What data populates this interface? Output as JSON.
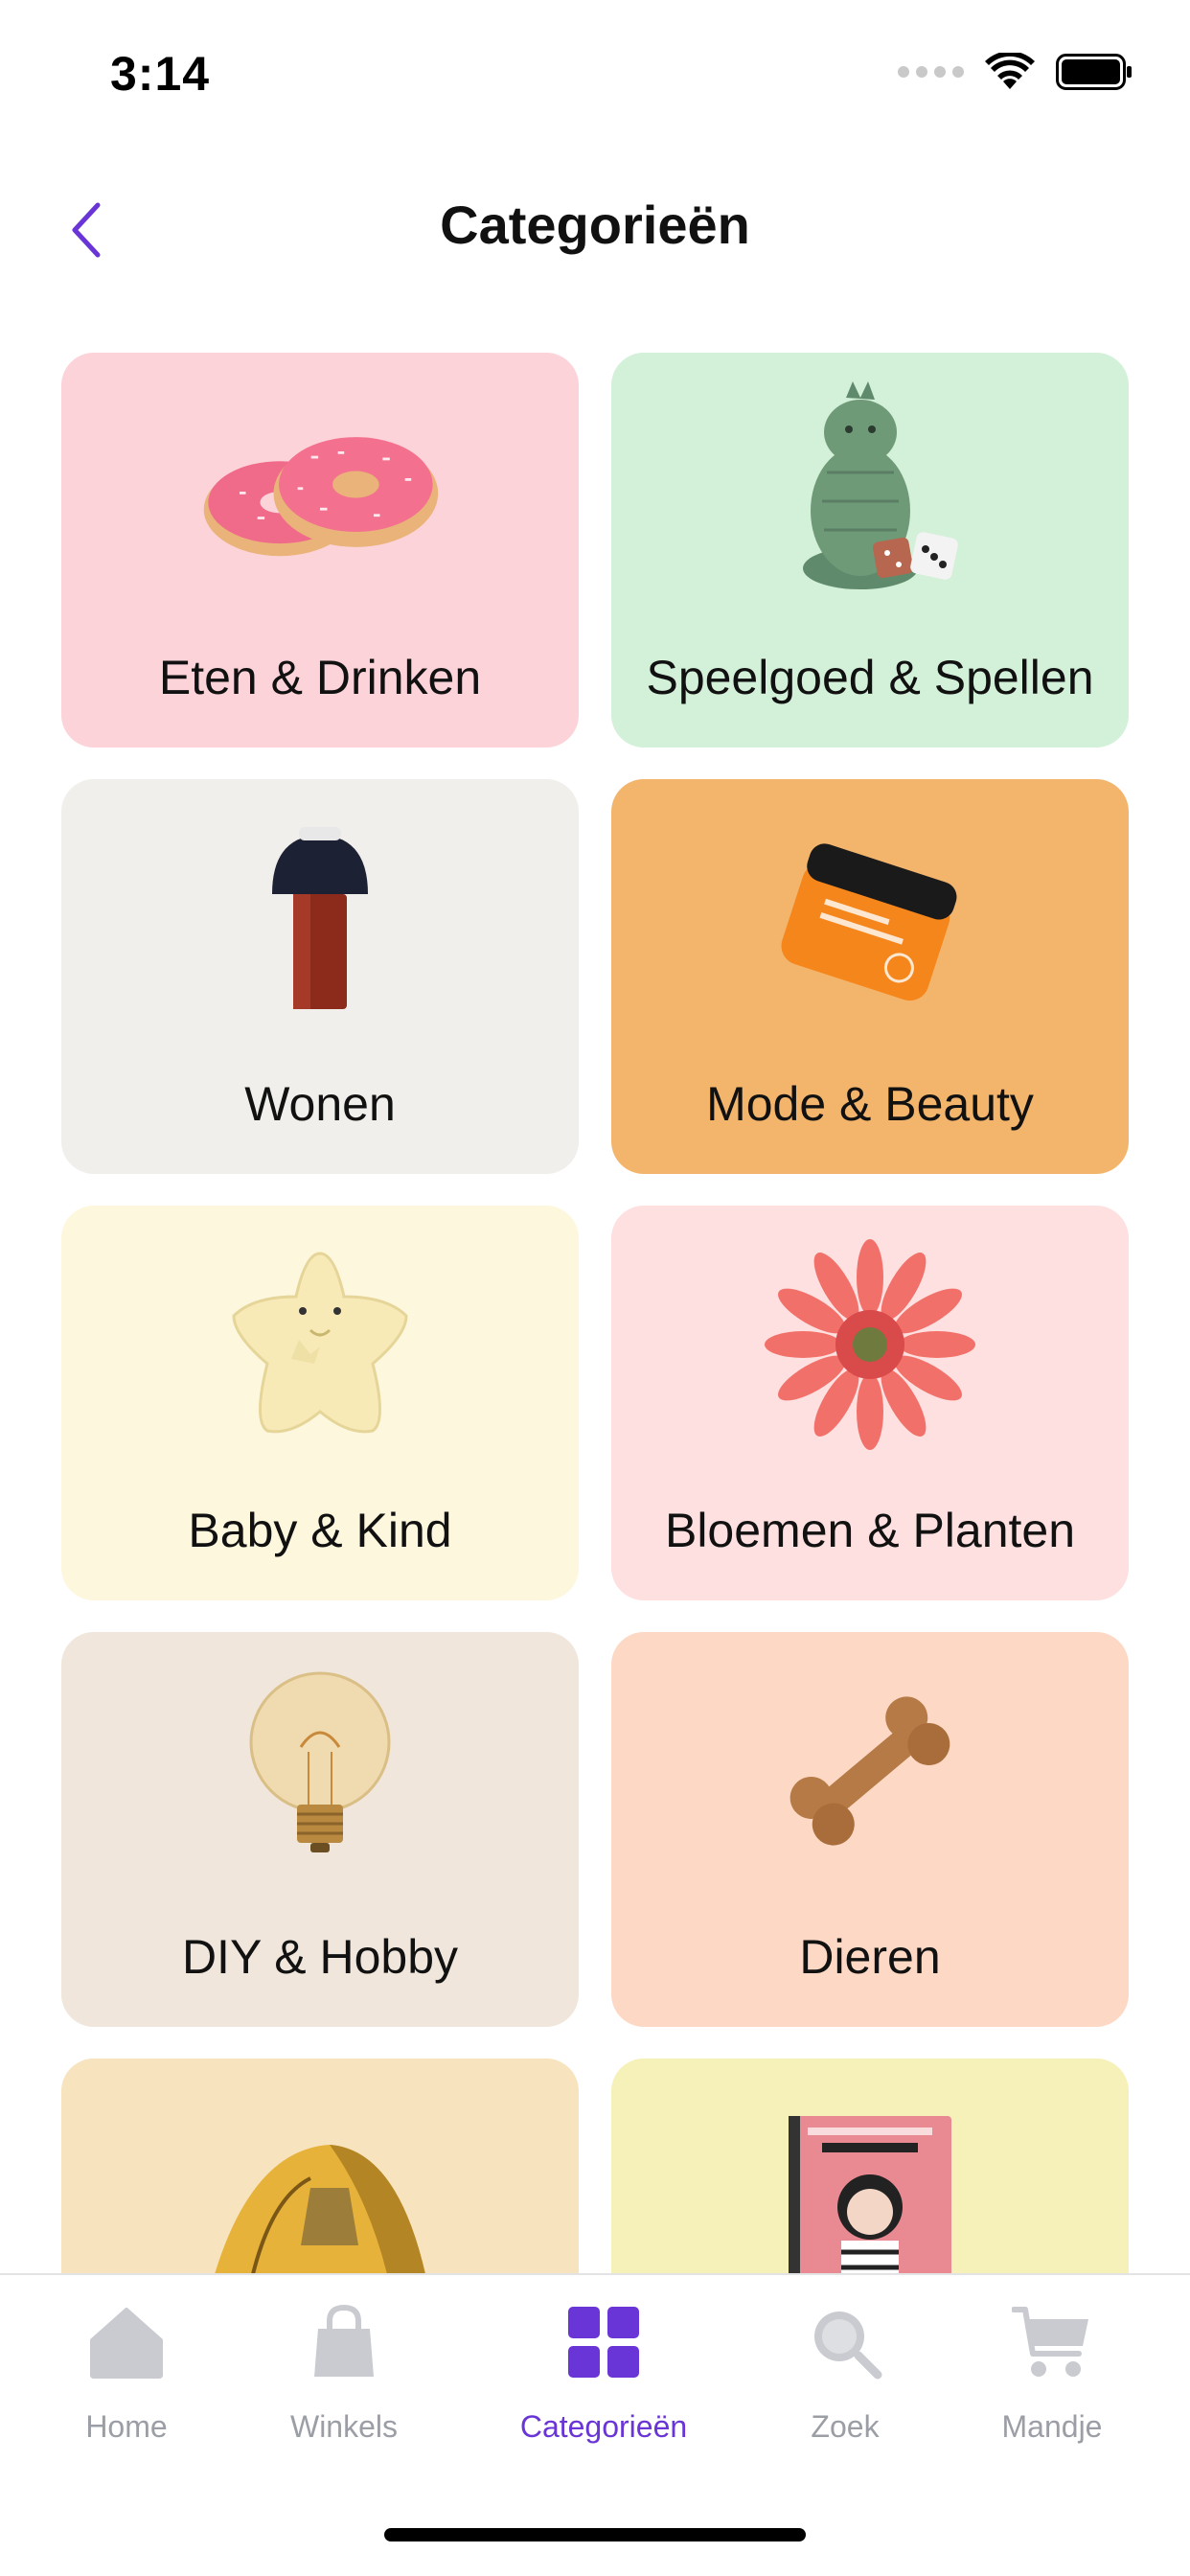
{
  "status_bar": {
    "time": "3:14"
  },
  "nav": {
    "title": "Categorieën"
  },
  "colors": {
    "accent": "#6a35d6",
    "tab_inactive": "#c9cbd0"
  },
  "categories": [
    {
      "label": "Eten & Drinken",
      "bg": "#fdd3da",
      "icon": "donuts-icon"
    },
    {
      "label": "Speelgoed & Spellen",
      "bg": "#d3f0d9",
      "icon": "plush-dino-dice-icon"
    },
    {
      "label": "Wonen",
      "bg": "#f1efeb",
      "icon": "table-lamp-icon"
    },
    {
      "label": "Mode & Beauty",
      "bg": "#f3b56c",
      "icon": "cosmetic-jar-icon"
    },
    {
      "label": "Baby & Kind",
      "bg": "#fdf7dd",
      "icon": "star-toy-icon"
    },
    {
      "label": "Bloemen & Planten",
      "bg": "#fde0df",
      "icon": "gerbera-flower-icon"
    },
    {
      "label": "DIY & Hobby",
      "bg": "#f0e6db",
      "icon": "light-bulb-icon"
    },
    {
      "label": "Dieren",
      "bg": "#fdd8c4",
      "icon": "dog-bone-icon"
    },
    {
      "label": "",
      "bg": "#f7e3bd",
      "icon": "tent-icon"
    },
    {
      "label": "",
      "bg": "#f6f1b8",
      "icon": "book-icon"
    }
  ],
  "tabs": [
    {
      "label": "Home",
      "icon": "home-icon",
      "active": false
    },
    {
      "label": "Winkels",
      "icon": "shopping-bag-icon",
      "active": false
    },
    {
      "label": "Categorieën",
      "icon": "grid-icon",
      "active": true
    },
    {
      "label": "Zoek",
      "icon": "search-icon",
      "active": false
    },
    {
      "label": "Mandje",
      "icon": "cart-icon",
      "active": false
    }
  ]
}
